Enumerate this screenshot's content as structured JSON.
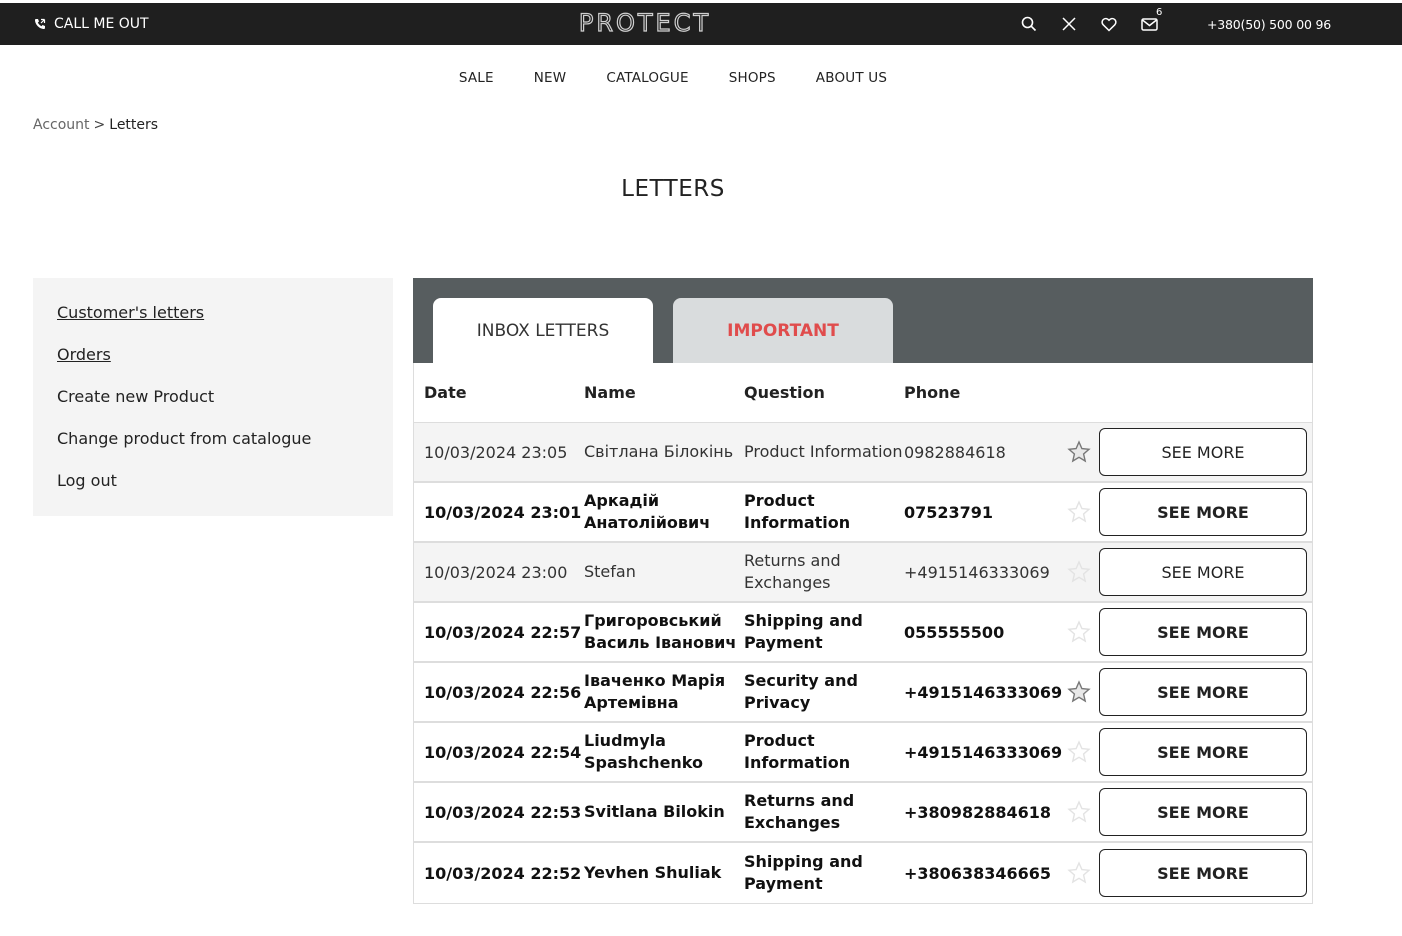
{
  "topbar": {
    "call_label": "CALL ME OUT",
    "logo_text": "PROTECT",
    "mail_count": "6",
    "phone": "+380(50) 500 00 96"
  },
  "nav": [
    "SALE",
    "NEW",
    "CATALOGUE",
    "SHOPS",
    "ABOUT US"
  ],
  "breadcrumb": {
    "parent": "Account",
    "separator": ">",
    "current": "Letters"
  },
  "page_title": "LETTERS",
  "sidebar": {
    "items": [
      "Customer's letters",
      "Orders",
      "Create new Product",
      "Change product from catalogue",
      "Log out"
    ]
  },
  "tabs": {
    "inbox": "INBOX LETTERS",
    "important": "IMPORTANT"
  },
  "table": {
    "headers": {
      "date": "Date",
      "name": "Name",
      "question": "Question",
      "phone": "Phone"
    },
    "button_label": "SEE MORE",
    "rows": [
      {
        "date": "10/03/2024 23:05",
        "name": "Світлана Білокінь",
        "question": "Product Information",
        "phone": "0982884618",
        "read": true,
        "starred": true
      },
      {
        "date": "10/03/2024 23:01",
        "name": "Аркадій Анатолійович",
        "question": "Product Information",
        "phone": "07523791",
        "read": false,
        "starred": false
      },
      {
        "date": "10/03/2024 23:00",
        "name": "Stefan",
        "question": "Returns and Exchanges",
        "phone": "+4915146333069",
        "read": true,
        "starred": false
      },
      {
        "date": "10/03/2024 22:57",
        "name": "Григоровський Василь Іванович",
        "question": "Shipping and Payment",
        "phone": "055555500",
        "read": false,
        "starred": false
      },
      {
        "date": "10/03/2024 22:56",
        "name": "Іваченко Марія Артемівна",
        "question": "Security and Privacy",
        "phone": "+4915146333069",
        "read": false,
        "starred": true
      },
      {
        "date": "10/03/2024 22:54",
        "name": "Liudmyla Spashchenko",
        "question": "Product Information",
        "phone": "+4915146333069",
        "read": false,
        "starred": false
      },
      {
        "date": "10/03/2024 22:53",
        "name": "Svitlana Bilokin",
        "question": "Returns and Exchanges",
        "phone": "+380982884618",
        "read": false,
        "starred": false
      },
      {
        "date": "10/03/2024 22:52",
        "name": "Yevhen Shuliak",
        "question": "Shipping and Payment",
        "phone": "+380638346665",
        "read": false,
        "starred": false
      }
    ]
  },
  "colors": {
    "topbar_bg": "#1f1f1f",
    "tabbar_bg": "#575d5f",
    "important_text": "#e04c4c"
  }
}
